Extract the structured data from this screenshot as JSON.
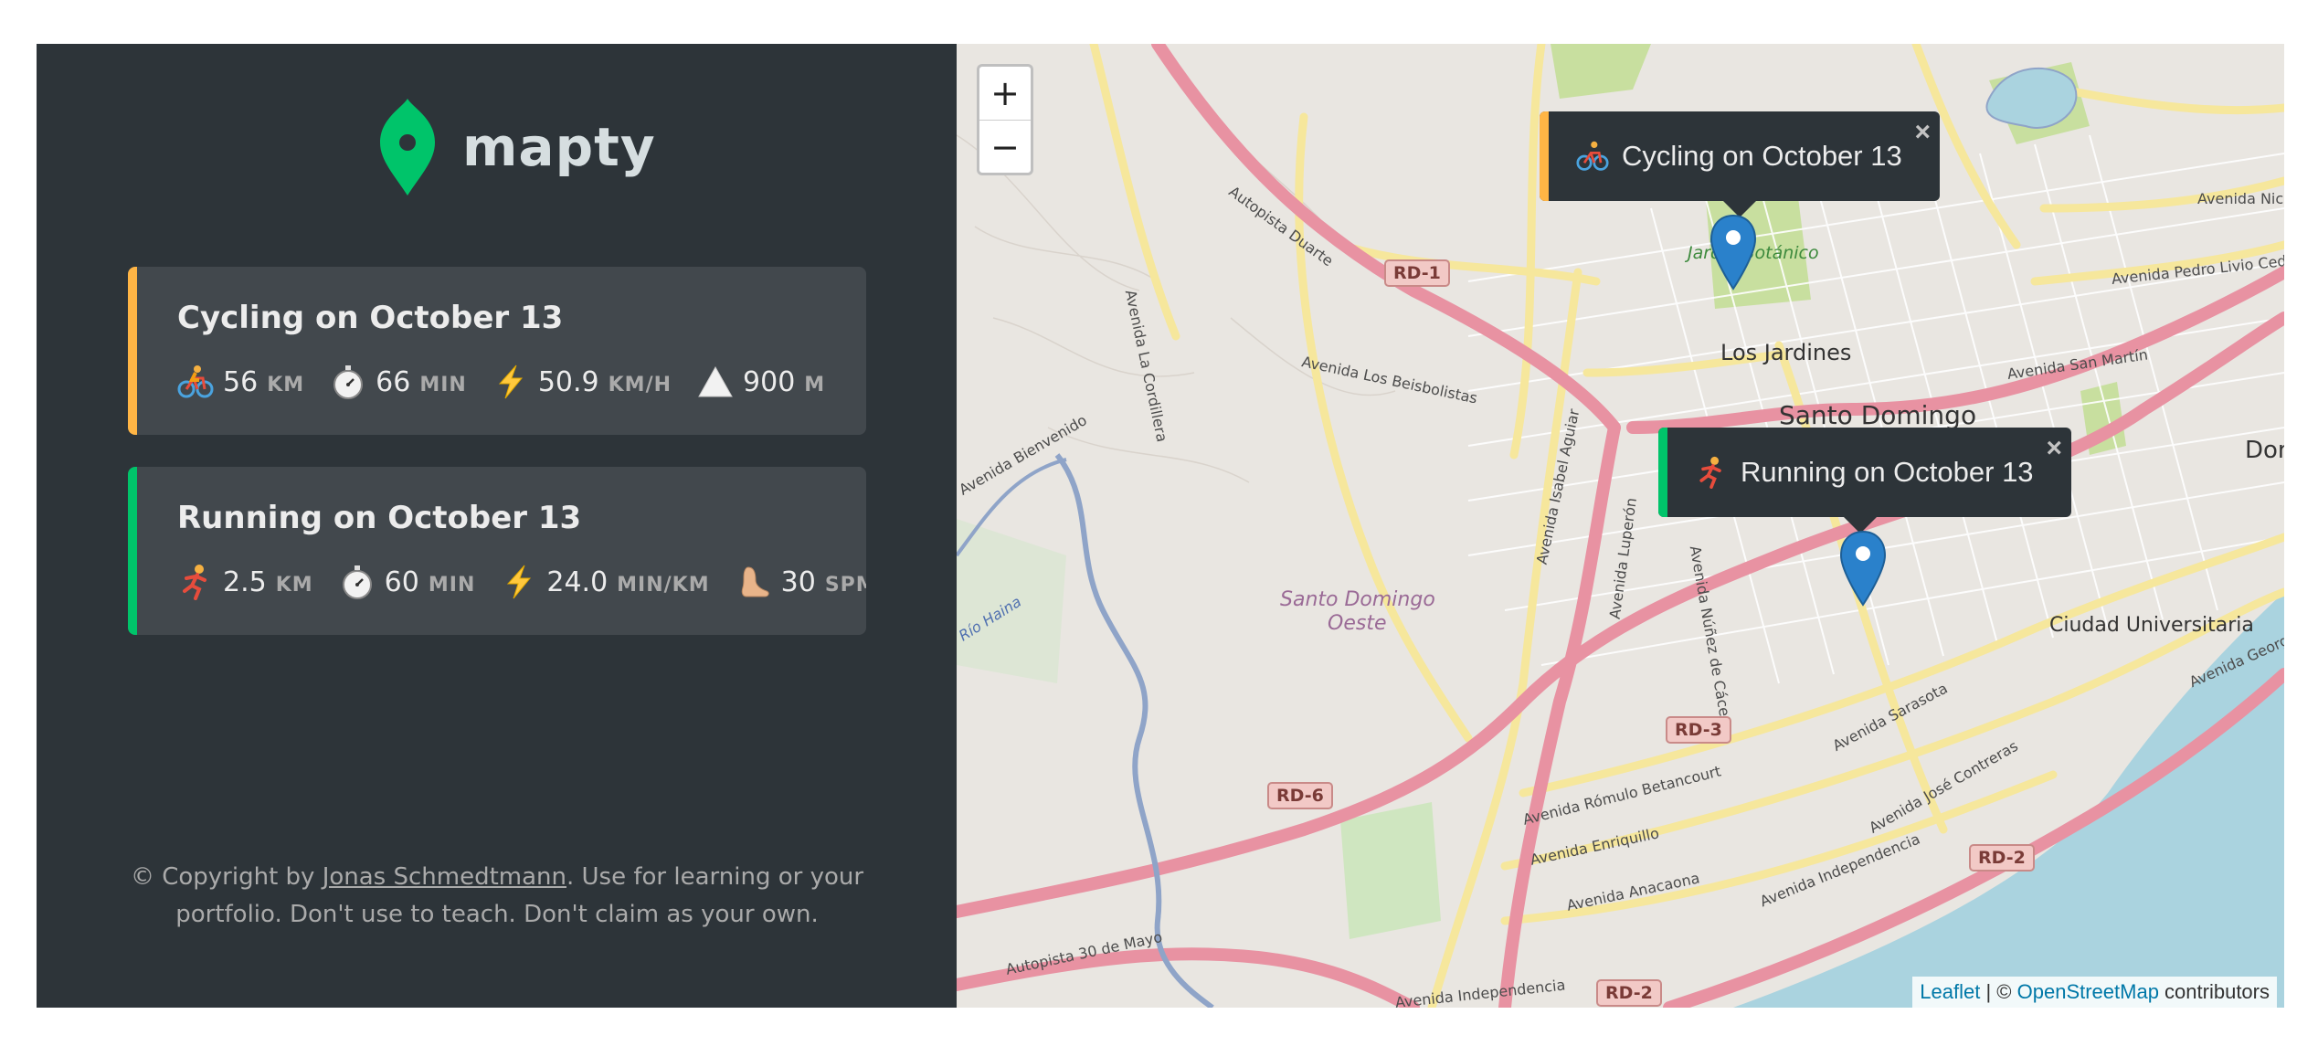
{
  "app": {
    "logo_text": "mapty",
    "brand_color_green": "#00c46a",
    "brand_color_orange": "#ffb545"
  },
  "workouts": [
    {
      "type": "cycling",
      "title": "Cycling on October 13",
      "accent": "#ffb545",
      "details": [
        {
          "icon": "bicycle-icon",
          "value": "56",
          "unit": "km"
        },
        {
          "icon": "stopwatch-icon",
          "value": "66",
          "unit": "min"
        },
        {
          "icon": "lightning-icon",
          "value": "50.9",
          "unit": "km/h"
        },
        {
          "icon": "mountain-icon",
          "value": "900",
          "unit": "m"
        }
      ]
    },
    {
      "type": "running",
      "title": "Running on October 13",
      "accent": "#00c46a",
      "details": [
        {
          "icon": "runner-icon",
          "value": "2.5",
          "unit": "km"
        },
        {
          "icon": "stopwatch-icon",
          "value": "60",
          "unit": "min"
        },
        {
          "icon": "lightning-icon",
          "value": "24.0",
          "unit": "min/km"
        },
        {
          "icon": "footprint-icon",
          "value": "30",
          "unit": "spm"
        }
      ]
    }
  ],
  "copyright": {
    "prefix": "© Copyright by ",
    "author": "Jonas Schmedtmann",
    "suffix": ". Use for learning or your portfolio. Don't use to teach. Don't claim as your own."
  },
  "map": {
    "zoom_in": "+",
    "zoom_out": "−",
    "popups": [
      {
        "icon": "bicycle-icon",
        "text": "Cycling on October 13",
        "close": "×"
      },
      {
        "icon": "runner-icon",
        "text": "Running on October 13",
        "close": "×"
      }
    ],
    "labels": {
      "los_jardines": "Los Jardines",
      "santo_domingo": "Santo Domingo",
      "ciudad_universitaria": "Ciudad Universitaria",
      "santo_domingo_oeste_1": "Santo Domingo",
      "santo_domingo_oeste_2": "Oeste",
      "jardin_botanico": "Jardín Botánico",
      "autopista_duarte": "Autopista Duarte",
      "avenida_los_beisbolistas": "Avenida Los Beisbolistas",
      "avenida_la_cordillera": "Avenida La Cordillera",
      "avenida_isabel_aguiar": "Avenida Isabel Aguiar",
      "avenida_luperon": "Avenida Luperón",
      "avenida_nunez_de_caceres": "Avenida Núñez de Cáceres",
      "avenida_romulo_betancourt": "Avenida Rómulo Betancourt",
      "avenida_enriquillo": "Avenida Enriquillo",
      "avenida_anacaona": "Avenida Anacaona",
      "avenida_independencia": "Avenida Independencia",
      "avenida_independencia_2": "Avenida Independencia",
      "avenida_sarasota": "Avenida Sarasota",
      "avenida_jose_contreras": "Avenida José Contreras",
      "avenida_san_martin": "Avenida San Martín",
      "avenida_pedro_livio": "Avenida Pedro Livio Cede",
      "avenida_nicolas": "Avenida Nicolás",
      "autopista_30_de_mayo": "Autopista 30 de Mayo",
      "avenida_george": "Avenida George W",
      "dom": "Dom",
      "rio_haina": "Río Haina",
      "autopista_edge": "Autop",
      "avenida_bienvenido": "Avenida Bienvenido"
    },
    "shields": {
      "rd1": "RD-1",
      "rd3": "RD-3",
      "rd6": "RD-6",
      "rd2a": "RD-2",
      "rd2b": "RD-2"
    },
    "attribution": {
      "leaflet": "Leaflet",
      "separator": " | © ",
      "osm": "OpenStreetMap",
      "contributors": " contributors"
    }
  }
}
